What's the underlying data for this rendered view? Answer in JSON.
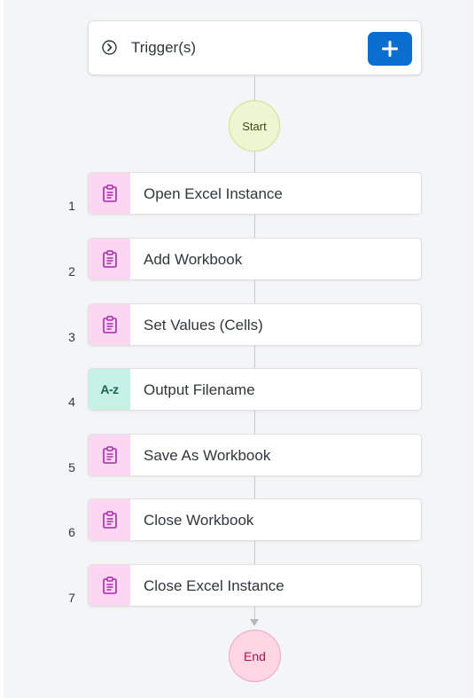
{
  "trigger": {
    "label": "Trigger(s)",
    "chevron_icon": "chevron-right-circle-icon",
    "add_icon": "plus-icon"
  },
  "start_node": {
    "label": "Start"
  },
  "end_node": {
    "label": "End"
  },
  "steps": [
    {
      "number": "1",
      "label": "Open Excel Instance",
      "icon": "clipboard-icon",
      "kind": "automation"
    },
    {
      "number": "2",
      "label": "Add Workbook",
      "icon": "clipboard-icon",
      "kind": "automation"
    },
    {
      "number": "3",
      "label": "Set Values (Cells)",
      "icon": "clipboard-icon",
      "kind": "automation"
    },
    {
      "number": "4",
      "label": "Output Filename",
      "icon": "a-z-icon",
      "icon_text": "A-z",
      "kind": "expression"
    },
    {
      "number": "5",
      "label": "Save As Workbook",
      "icon": "clipboard-icon",
      "kind": "automation"
    },
    {
      "number": "6",
      "label": "Close Workbook",
      "icon": "clipboard-icon",
      "kind": "automation"
    },
    {
      "number": "7",
      "label": "Close Excel Instance",
      "icon": "clipboard-icon",
      "kind": "automation"
    }
  ],
  "colors": {
    "add_button": "#0a6ed1",
    "automation_icon_bg": "#fbd7f2",
    "automation_icon_fg": "#a72aa7",
    "expression_icon_bg": "#c6f2e6",
    "start_bg": "#eef5d3",
    "end_bg": "#ffd6e4"
  }
}
